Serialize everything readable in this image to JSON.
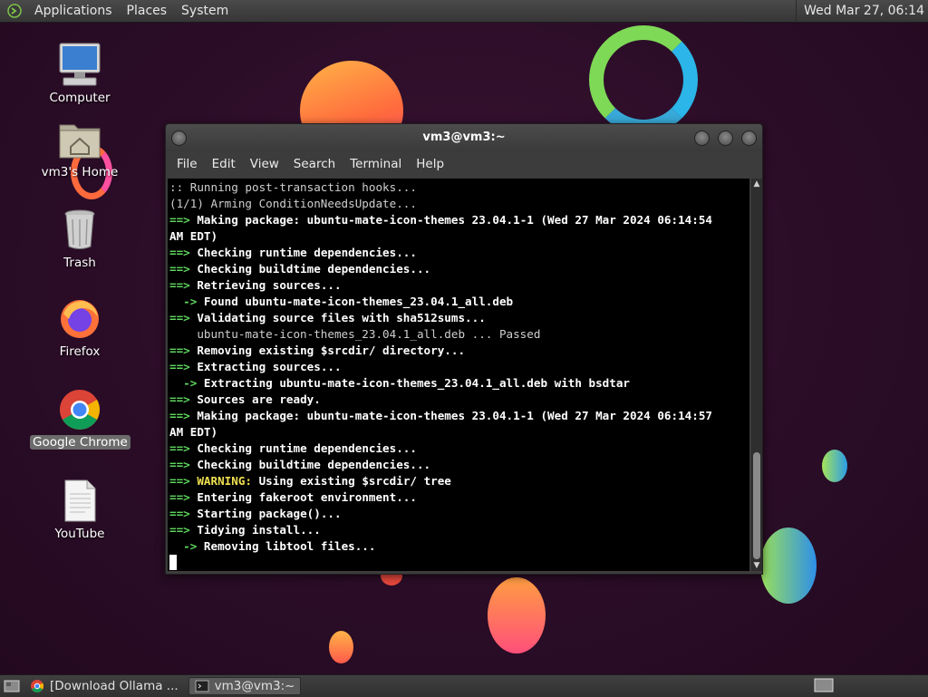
{
  "top_panel": {
    "menus": [
      "Applications",
      "Places",
      "System"
    ],
    "clock": "Wed Mar 27, 06:14"
  },
  "desktop_icons": [
    {
      "label": "Computer",
      "icon": "computer-icon"
    },
    {
      "label": "vm3's Home",
      "icon": "home-folder-icon"
    },
    {
      "label": "Trash",
      "icon": "trash-icon"
    },
    {
      "label": "Firefox",
      "icon": "firefox-icon"
    },
    {
      "label": "Google Chrome",
      "icon": "chrome-icon",
      "selected": true
    },
    {
      "label": "YouTube",
      "icon": "document-icon"
    }
  ],
  "terminal": {
    "title": "vm3@vm3:~",
    "menu": [
      "File",
      "Edit",
      "View",
      "Search",
      "Terminal",
      "Help"
    ],
    "lines": [
      {
        "text": ":: Running post-transaction hooks..."
      },
      {
        "text": "(1/1) Arming ConditionNeedsUpdate..."
      },
      {
        "prefix": "==>",
        "text": "Making package: ubuntu-mate-icon-themes 23.04.1-1 (Wed 27 Mar 2024 06:14:54"
      },
      {
        "text": "AM EDT)",
        "style": "bold"
      },
      {
        "prefix": "==>",
        "text": "Checking runtime dependencies..."
      },
      {
        "prefix": "==>",
        "text": "Checking buildtime dependencies..."
      },
      {
        "prefix": "==>",
        "text": "Retrieving sources..."
      },
      {
        "prefix": "  ->",
        "text": "Found ubuntu-mate-icon-themes_23.04.1_all.deb"
      },
      {
        "prefix": "==>",
        "text": "Validating source files with sha512sums..."
      },
      {
        "text": "    ubuntu-mate-icon-themes_23.04.1_all.deb ... Passed"
      },
      {
        "prefix": "==>",
        "text": "Removing existing $srcdir/ directory..."
      },
      {
        "prefix": "==>",
        "text": "Extracting sources..."
      },
      {
        "prefix": "  ->",
        "text": "Extracting ubuntu-mate-icon-themes_23.04.1_all.deb with bsdtar"
      },
      {
        "prefix": "==>",
        "text": "Sources are ready."
      },
      {
        "prefix": "==>",
        "text": "Making package: ubuntu-mate-icon-themes 23.04.1-1 (Wed 27 Mar 2024 06:14:57"
      },
      {
        "text": "AM EDT)",
        "style": "bold"
      },
      {
        "prefix": "==>",
        "text": "Checking runtime dependencies..."
      },
      {
        "prefix": "==>",
        "text": "Checking buildtime dependencies..."
      },
      {
        "prefix": "==>",
        "warn": "WARNING:",
        "text": "Using existing $srcdir/ tree"
      },
      {
        "prefix": "==>",
        "text": "Entering fakeroot environment..."
      },
      {
        "prefix": "==>",
        "text": "Starting package()..."
      },
      {
        "prefix": "==>",
        "text": "Tidying install..."
      },
      {
        "prefix": "  ->",
        "text": "Removing libtool files..."
      }
    ]
  },
  "taskbar": {
    "tasks": [
      {
        "label": "[Download Ollama ...",
        "icon": "chrome-icon",
        "active": false
      },
      {
        "label": "vm3@vm3:~",
        "icon": "terminal-icon",
        "active": true
      }
    ]
  },
  "colors": {
    "prompt_arrow": "#5fd75f",
    "warning": "#f0e050",
    "panel": "#3c3c3c"
  }
}
